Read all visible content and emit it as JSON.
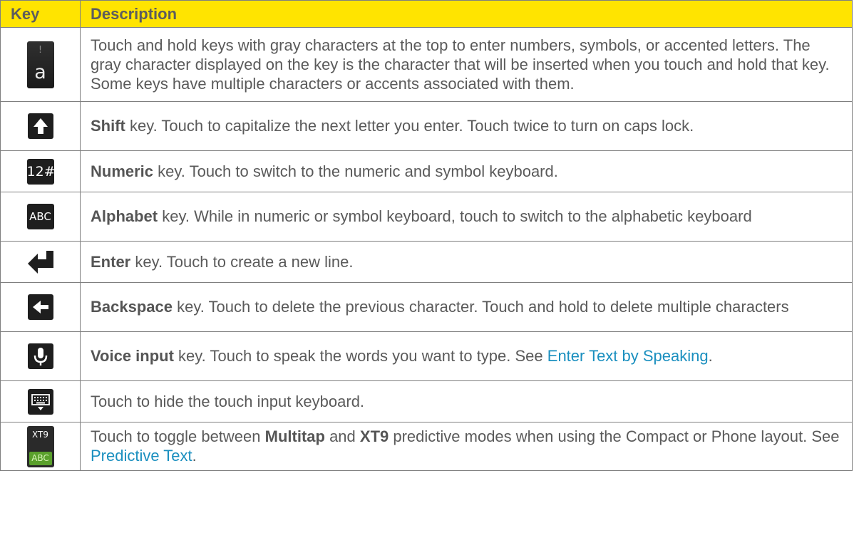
{
  "header": {
    "key": "Key",
    "description": "Description"
  },
  "rows": [
    {
      "icon": "accented-letter-key-icon",
      "key_hint": "!",
      "key_letter": "a",
      "pre": "",
      "bold": "",
      "text": "Touch and hold keys with gray characters at the top to enter numbers, symbols, or accented letters. The gray character displayed on the key is the character that will be inserted when you touch and hold that key. Some keys have multiple characters or accents associated with them.",
      "link": "",
      "post": ""
    },
    {
      "icon": "shift-key-icon",
      "bold": "Shift",
      "text": " key. Touch to capitalize the next letter you enter. Touch twice to turn on caps lock."
    },
    {
      "icon": "numeric-key-icon",
      "key_label": "12#",
      "bold": "Numeric",
      "text": " key. Touch to switch to the numeric and symbol keyboard."
    },
    {
      "icon": "alphabet-key-icon",
      "key_label": "ABC",
      "bold": "Alphabet",
      "text": " key. While in numeric or symbol keyboard, touch to switch to the alphabetic keyboard"
    },
    {
      "icon": "enter-key-icon",
      "bold": "Enter",
      "text": " key. Touch to create a new line."
    },
    {
      "icon": "backspace-key-icon",
      "bold": "Backspace",
      "text": " key. Touch to delete the previous character. Touch and hold to delete multiple characters"
    },
    {
      "icon": "microphone-key-icon",
      "bold": "Voice input",
      "text": " key. Touch to speak the words you want to type. See ",
      "link": "Enter Text by Speaking",
      "post": "."
    },
    {
      "icon": "hide-keyboard-icon",
      "text": "Touch to hide the touch input keyboard."
    },
    {
      "icon": "xt9-abc-key-icon",
      "key_top": "XT9",
      "key_bottom": "ABC",
      "text1": "Touch to toggle between ",
      "bold1": "Multitap",
      "text2": " and ",
      "bold2": "XT9",
      "text3": " predictive modes when using the Compact or Phone layout. See ",
      "link": "Predictive Text",
      "post": "."
    }
  ]
}
